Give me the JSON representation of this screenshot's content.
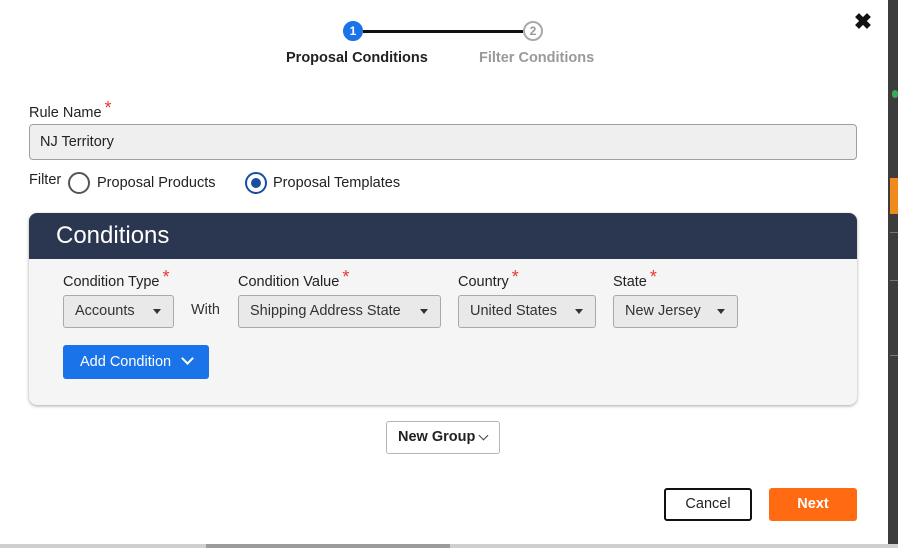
{
  "stepper": {
    "steps": [
      {
        "number": "1",
        "label": "Proposal Conditions",
        "state": "active"
      },
      {
        "number": "2",
        "label": "Filter Conditions",
        "state": "inactive"
      }
    ]
  },
  "form": {
    "rule_name_label": "Rule Name",
    "required_mark": "*",
    "rule_name_value": "NJ Territory",
    "filter_label": "Filter",
    "filter_options": [
      {
        "label": "Proposal Products",
        "selected": false
      },
      {
        "label": "Proposal Templates",
        "selected": true
      }
    ]
  },
  "conditions": {
    "title": "Conditions",
    "with_text": "With",
    "fields": [
      {
        "label": "Condition Type",
        "value": "Accounts"
      },
      {
        "label": "Condition Value",
        "value": "Shipping Address State"
      },
      {
        "label": "Country",
        "value": "United States"
      },
      {
        "label": "State",
        "value": "New Jersey"
      }
    ],
    "add_condition_label": "Add Condition"
  },
  "new_group_label": "New Group",
  "footer": {
    "cancel_label": "Cancel",
    "next_label": "Next"
  },
  "colors": {
    "header_bg": "#2b3650",
    "primary_blue": "#1a73e8",
    "next_orange": "#ff6a13",
    "required_red": "#e53935"
  },
  "icons": {
    "close": "close-icon",
    "caret": "caret-down-icon",
    "chevron": "chevron-down-icon"
  }
}
